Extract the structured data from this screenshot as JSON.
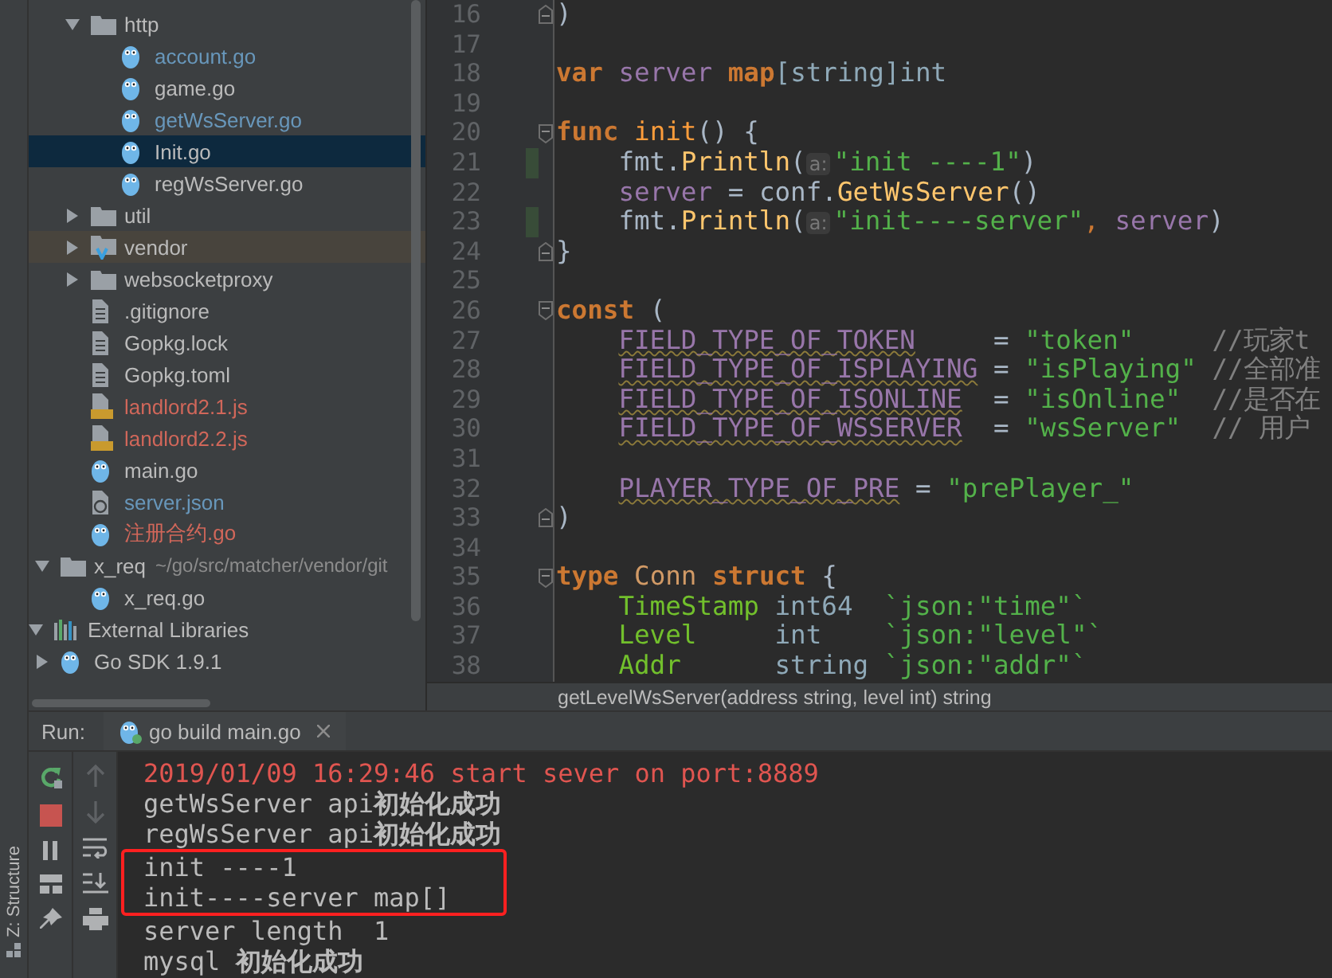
{
  "tree": [
    {
      "children": [
        {
          "children": [
            {
              "label": "http",
              "kind": "folder",
              "expanded": true,
              "selected": false,
              "highlighted": false,
              "color": "#bbbbbb",
              "children": [
                {
                  "label": "account.go",
                  "kind": "go",
                  "selected": false,
                  "highlighted": false,
                  "color": "#6897bb"
                },
                {
                  "label": "game.go",
                  "kind": "go",
                  "selected": false,
                  "highlighted": false,
                  "color": "#bbbbbb"
                },
                {
                  "label": "getWsServer.go",
                  "kind": "go",
                  "selected": false,
                  "highlighted": false,
                  "color": "#6897bb"
                },
                {
                  "label": "Init.go",
                  "kind": "go",
                  "selected": true,
                  "highlighted": false,
                  "color": "#bbbbbb"
                },
                {
                  "label": "regWsServer.go",
                  "kind": "go",
                  "selected": false,
                  "highlighted": false,
                  "color": "#bbbbbb"
                }
              ]
            },
            {
              "label": "util",
              "kind": "folder",
              "expanded": false,
              "selected": false,
              "highlighted": false,
              "color": "#bbbbbb"
            },
            {
              "label": "vendor",
              "kind": "vendor",
              "expanded": false,
              "selected": false,
              "highlighted": true,
              "color": "#bbbbbb"
            },
            {
              "label": "websocketproxy",
              "kind": "folder",
              "expanded": false,
              "selected": false,
              "highlighted": false,
              "color": "#bbbbbb"
            },
            {
              "label": ".gitignore",
              "kind": "file",
              "selected": false,
              "highlighted": false,
              "color": "#bbbbbb"
            },
            {
              "label": "Gopkg.lock",
              "kind": "file",
              "selected": false,
              "highlighted": false,
              "color": "#bbbbbb"
            },
            {
              "label": "Gopkg.toml",
              "kind": "file",
              "selected": false,
              "highlighted": false,
              "color": "#bbbbbb"
            },
            {
              "label": "landlord2.1.js",
              "kind": "js",
              "selected": false,
              "highlighted": false,
              "color": "#d1675a"
            },
            {
              "label": "landlord2.2.js",
              "kind": "js",
              "selected": false,
              "highlighted": false,
              "color": "#d1675a"
            },
            {
              "label": "main.go",
              "kind": "go",
              "selected": false,
              "highlighted": false,
              "color": "#bbbbbb"
            },
            {
              "label": "server.json",
              "kind": "json",
              "selected": false,
              "highlighted": false,
              "color": "#6897bb"
            },
            {
              "label": "注册合约.go",
              "kind": "go",
              "selected": false,
              "highlighted": false,
              "color": "#d1675a"
            }
          ]
        },
        {
          "label": "x_req",
          "hint": "~/go/src/matcher/vendor/git",
          "kind": "folder",
          "expanded": true,
          "selected": false,
          "highlighted": false,
          "color": "#bbbbbb",
          "children": [
            {
              "label": "x_req.go",
              "kind": "go",
              "selected": false,
              "highlighted": false,
              "color": "#bbbbbb"
            }
          ]
        }
      ]
    },
    {
      "label": "External Libraries",
      "kind": "library",
      "expanded": true,
      "selected": false,
      "highlighted": false,
      "color": "#bbbbbb",
      "children": [
        {
          "label": "Go SDK 1.9.1",
          "kind": "go",
          "expanded": false,
          "selected": false,
          "highlighted": false,
          "color": "#bbbbbb"
        }
      ]
    }
  ],
  "code": [
    {
      "number": "16",
      "fold_end": true,
      "tokens": [
        {
          "kind": "plain",
          "text": ")"
        }
      ]
    },
    {
      "number": "17"
    },
    {
      "number": "18",
      "tokens": [
        {
          "kind": "keyword",
          "text": "var"
        },
        {
          "kind": "ident",
          "text": " server"
        },
        {
          "kind": "keyword",
          "text": " map"
        },
        {
          "kind": "type",
          "text": "[string]int"
        }
      ]
    },
    {
      "number": "19"
    },
    {
      "number": "20",
      "fold_start": true,
      "tokens": [
        {
          "kind": "keyword",
          "text": "func"
        },
        {
          "kind": "funcname",
          "text": " init"
        },
        {
          "kind": "plain",
          "text": "() {"
        }
      ]
    },
    {
      "number": "21",
      "changed": true,
      "indent": true,
      "tokens": [
        {
          "kind": "plain",
          "text": "fmt."
        },
        {
          "kind": "method",
          "text": "Println"
        },
        {
          "kind": "plain",
          "text": "("
        },
        {
          "kind": "hint",
          "text": "a:"
        },
        {
          "kind": "string",
          "text": "\"init ----1\""
        },
        {
          "kind": "plain",
          "text": ")"
        }
      ]
    },
    {
      "number": "22",
      "indent": true,
      "tokens": [
        {
          "kind": "ident",
          "text": "server"
        },
        {
          "kind": "plain",
          "text": " = conf."
        },
        {
          "kind": "method",
          "text": "GetWsServer"
        },
        {
          "kind": "plain",
          "text": "()"
        }
      ]
    },
    {
      "number": "23",
      "changed": true,
      "indent": true,
      "tokens": [
        {
          "kind": "plain",
          "text": "fmt."
        },
        {
          "kind": "method",
          "text": "Println"
        },
        {
          "kind": "plain",
          "text": "("
        },
        {
          "kind": "hint",
          "text": "a:"
        },
        {
          "kind": "string",
          "text": "\"init----server\""
        },
        {
          "kind": "comma",
          "text": ","
        },
        {
          "kind": "ident",
          "text": " server"
        },
        {
          "kind": "plain",
          "text": ")"
        }
      ]
    },
    {
      "number": "24",
      "fold_end": true,
      "tokens": [
        {
          "kind": "plain",
          "text": "}"
        }
      ]
    },
    {
      "number": "25"
    },
    {
      "number": "26",
      "fold_start": true,
      "tokens": [
        {
          "kind": "keyword",
          "text": "const"
        },
        {
          "kind": "plain",
          "text": " ("
        }
      ]
    },
    {
      "number": "27",
      "indent": true,
      "tokens": [
        {
          "kind": "const",
          "text": "FIELD_TYPE_OF_TOKEN"
        },
        {
          "kind": "plain",
          "text": "     = "
        },
        {
          "kind": "string",
          "text": "\"token\"     "
        },
        {
          "kind": "comment",
          "text": "//玩家t"
        }
      ]
    },
    {
      "number": "28",
      "indent": true,
      "tokens": [
        {
          "kind": "const",
          "text": "FIELD_TYPE_OF_ISPLAYING"
        },
        {
          "kind": "plain",
          "text": " = "
        },
        {
          "kind": "string",
          "text": "\"isPlaying\" "
        },
        {
          "kind": "comment",
          "text": "//全部准"
        }
      ]
    },
    {
      "number": "29",
      "indent": true,
      "tokens": [
        {
          "kind": "const",
          "text": "FIELD_TYPE_OF_ISONLINE"
        },
        {
          "kind": "plain",
          "text": "  = "
        },
        {
          "kind": "string",
          "text": "\"isOnline\"  "
        },
        {
          "kind": "comment",
          "text": "//是否在"
        }
      ]
    },
    {
      "number": "30",
      "indent": true,
      "tokens": [
        {
          "kind": "const",
          "text": "FIELD_TYPE_OF_WSSERVER"
        },
        {
          "kind": "plain",
          "text": "  = "
        },
        {
          "kind": "string",
          "text": "\"wsServer\"  "
        },
        {
          "kind": "comment",
          "text": "// 用户"
        }
      ]
    },
    {
      "number": "31"
    },
    {
      "number": "32",
      "indent": true,
      "tokens": [
        {
          "kind": "const",
          "text": "PLAYER_TYPE_OF_PRE"
        },
        {
          "kind": "plain",
          "text": " = "
        },
        {
          "kind": "string",
          "text": "\"prePlayer_\""
        }
      ]
    },
    {
      "number": "33",
      "fold_end": true,
      "tokens": [
        {
          "kind": "plain",
          "text": ")"
        }
      ]
    },
    {
      "number": "34"
    },
    {
      "number": "35",
      "fold_start": true,
      "tokens": [
        {
          "kind": "keyword",
          "text": "type"
        },
        {
          "kind": "typename",
          "text": " Conn"
        },
        {
          "kind": "keyword",
          "text": " struct"
        },
        {
          "kind": "plain",
          "text": " {"
        }
      ]
    },
    {
      "number": "36",
      "indent": true,
      "tokens": [
        {
          "kind": "field",
          "text": "TimeStamp"
        },
        {
          "kind": "type",
          "text": " int64  "
        },
        {
          "kind": "string",
          "text": "`json:\"time\"`"
        }
      ]
    },
    {
      "number": "37",
      "indent": true,
      "tokens": [
        {
          "kind": "field",
          "text": "Level"
        },
        {
          "kind": "type",
          "text": "     int    "
        },
        {
          "kind": "string",
          "text": "`json:\"level\"`"
        }
      ]
    },
    {
      "number": "38",
      "indent": true,
      "tokens": [
        {
          "kind": "field",
          "text": "Addr"
        },
        {
          "kind": "type",
          "text": "      string "
        },
        {
          "kind": "string",
          "text": "`json:\"addr\"`"
        }
      ]
    }
  ],
  "signature_hint": "getLevelWsServer(address string, level int) string",
  "run_panel": {
    "label": "Run:",
    "tab": "go build main.go"
  },
  "console": [
    {
      "kind": "error",
      "text": "2019/01/09 16:29:46 start sever on port:8889",
      "boxed": false
    },
    {
      "kind": "output",
      "text": "getWsServer api**初始化成功**",
      "boxed": false
    },
    {
      "kind": "output",
      "text": "regWsServer api**初始化成功**",
      "boxed": false
    },
    {
      "kind": "output",
      "text": "init ----1",
      "boxed": true
    },
    {
      "kind": "output",
      "text": "init----server map[]",
      "boxed": true
    },
    {
      "kind": "output",
      "text": "server length  1",
      "boxed": false
    },
    {
      "kind": "output",
      "text": "mysql **初始化成功**",
      "boxed": false
    }
  ],
  "side_strip": {
    "label": "Z: Structure"
  }
}
